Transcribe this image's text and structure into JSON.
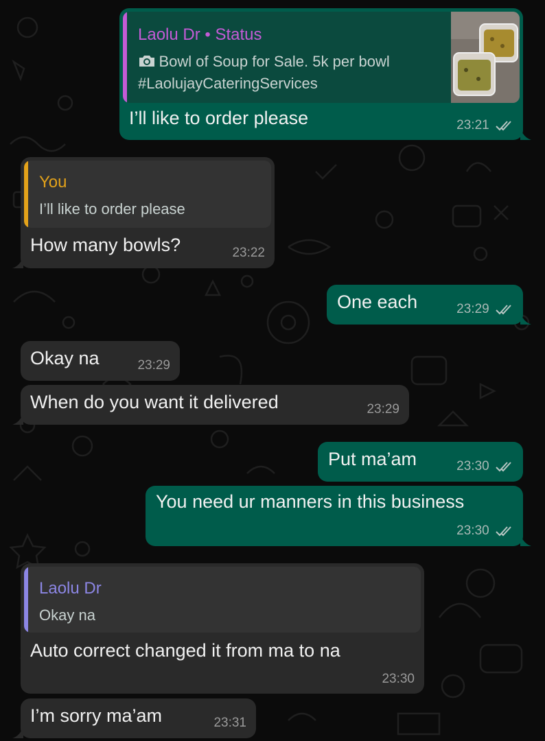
{
  "colors": {
    "outgoing_bubble": "#005c4b",
    "incoming_bubble": "#2a2a2a",
    "status_accent": "#c45bd6",
    "you_accent": "#e3a21a",
    "laolu_accent": "#8c86e4"
  },
  "messages": [
    {
      "direction": "outgoing",
      "quote": {
        "author": "Laolu Dr • Status",
        "icon": "camera-icon",
        "line1": "Bowl of Soup for Sale. 5k per bowl",
        "line2": "#LaolujayCateringServices",
        "thumbnail": "soup-bowls-thumbnail"
      },
      "text": "I’ll like to order please",
      "time": "23:21",
      "read": true
    },
    {
      "direction": "incoming",
      "quote": {
        "author": "You",
        "line1": "I’ll like to order please"
      },
      "text": "How many bowls?",
      "time": "23:22"
    },
    {
      "direction": "outgoing",
      "text": "One each",
      "time": "23:29",
      "read": true
    },
    {
      "direction": "incoming",
      "text": "Okay na",
      "time": "23:29"
    },
    {
      "direction": "incoming",
      "text": "When do you want it delivered",
      "time": "23:29"
    },
    {
      "direction": "outgoing",
      "text": "Put ma’am",
      "time": "23:30",
      "read": true
    },
    {
      "direction": "outgoing",
      "text": "You need ur manners in this business",
      "time": "23:30",
      "read": true
    },
    {
      "direction": "incoming",
      "quote": {
        "author": "Laolu Dr",
        "line1": "Okay na"
      },
      "text": "Auto correct changed it from ma to na",
      "time": "23:30"
    },
    {
      "direction": "incoming",
      "text": "I’m sorry ma’am",
      "time": "23:31"
    }
  ]
}
